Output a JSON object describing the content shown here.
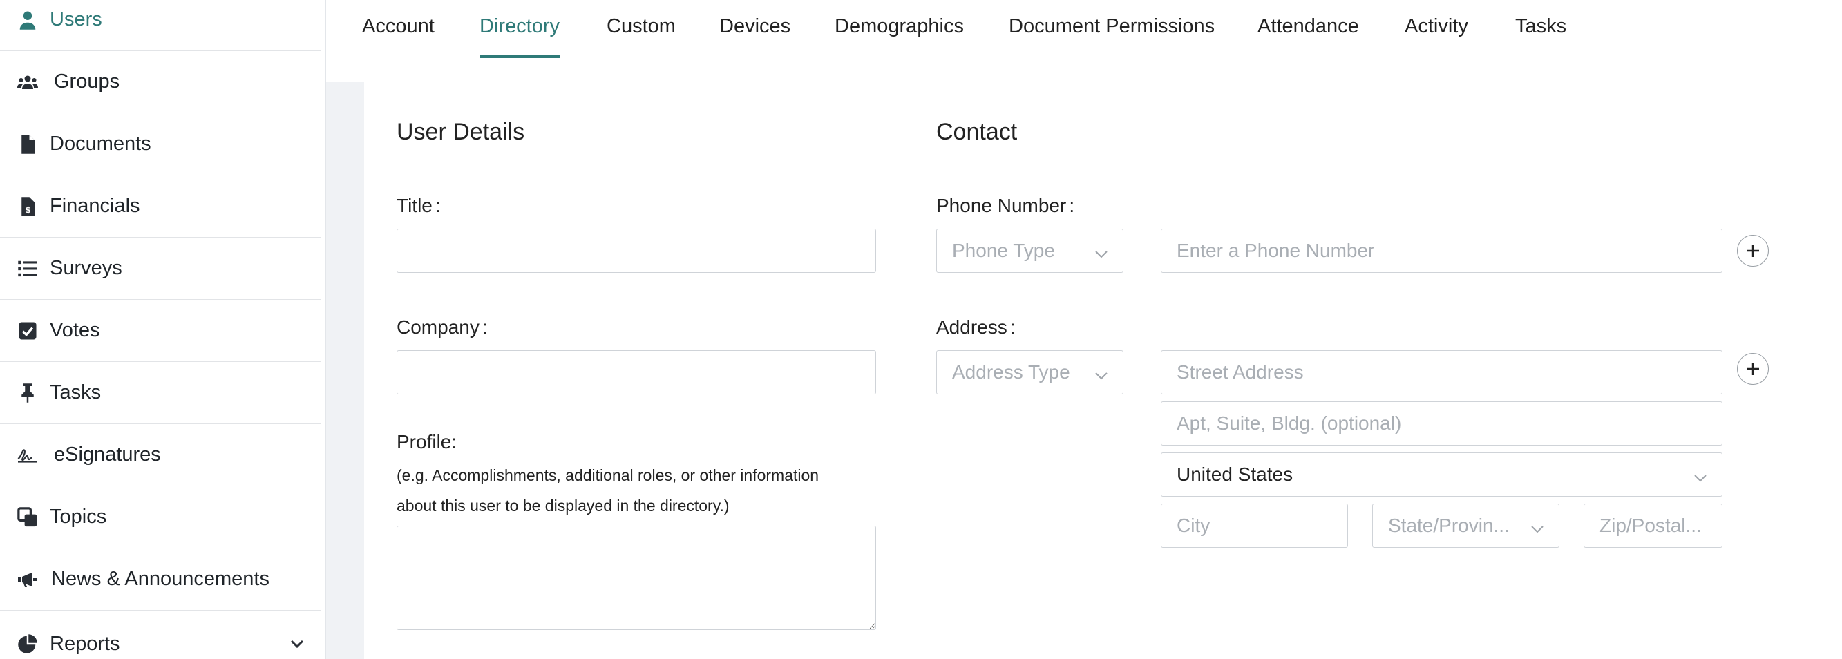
{
  "colors": {
    "accent": "#2f7a78",
    "background": "#f0f2f5",
    "border": "#cfd3d8"
  },
  "sidebar": {
    "items": [
      {
        "label": "Users",
        "icon": "user-icon"
      },
      {
        "label": "Groups",
        "icon": "users-icon"
      },
      {
        "label": "Documents",
        "icon": "file-icon"
      },
      {
        "label": "Financials",
        "icon": "file-invoice-dollar-icon"
      },
      {
        "label": "Surveys",
        "icon": "list-icon"
      },
      {
        "label": "Votes",
        "icon": "check-square-icon"
      },
      {
        "label": "Tasks",
        "icon": "thumbtack-icon"
      },
      {
        "label": "eSignatures",
        "icon": "signature-icon"
      },
      {
        "label": "Topics",
        "icon": "clone-icon"
      },
      {
        "label": "News & Announcements",
        "icon": "bullhorn-icon"
      },
      {
        "label": "Reports",
        "icon": "chart-pie-icon"
      }
    ]
  },
  "tabs": [
    {
      "label": "Account"
    },
    {
      "label": "Directory"
    },
    {
      "label": "Custom"
    },
    {
      "label": "Devices"
    },
    {
      "label": "Demographics"
    },
    {
      "label": "Document Permissions"
    },
    {
      "label": "Attendance"
    },
    {
      "label": "Activity"
    },
    {
      "label": "Tasks"
    }
  ],
  "user_details": {
    "title": "User Details",
    "title_label": "Title",
    "company_label": "Company",
    "profile_label": "Profile:",
    "profile_hint_1": "(e.g. Accomplishments, additional roles, or other information",
    "profile_hint_2": "about this user to be displayed in the directory.)"
  },
  "contact": {
    "title": "Contact",
    "phone_label": "Phone Number",
    "phone_type_placeholder": "Phone Type",
    "phone_placeholder": "Enter a Phone Number",
    "address_label": "Address",
    "address_type_placeholder": "Address Type",
    "street_placeholder": "Street Address",
    "apt_placeholder": "Apt, Suite, Bldg. (optional)",
    "country_value": "United States",
    "city_placeholder": "City",
    "state_placeholder": "State/Provin...",
    "zip_placeholder": "Zip/Postal..."
  },
  "required_mark": ":"
}
